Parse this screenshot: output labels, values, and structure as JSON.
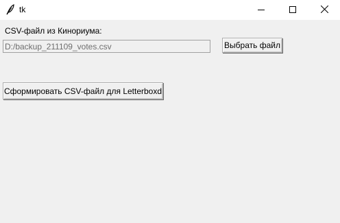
{
  "window": {
    "title": "tk",
    "icons": {
      "app": "feather-icon",
      "minimize": "minimize-icon",
      "maximize": "maximize-icon",
      "close": "close-icon"
    }
  },
  "form": {
    "csv_label": "CSV-файл из Кинориума:",
    "file_path_value": "D:/backup_211109_votes.csv",
    "browse_button_label": "Выбрать файл",
    "generate_button_label": "Сформировать CSV-файл для Letterboxd"
  }
}
